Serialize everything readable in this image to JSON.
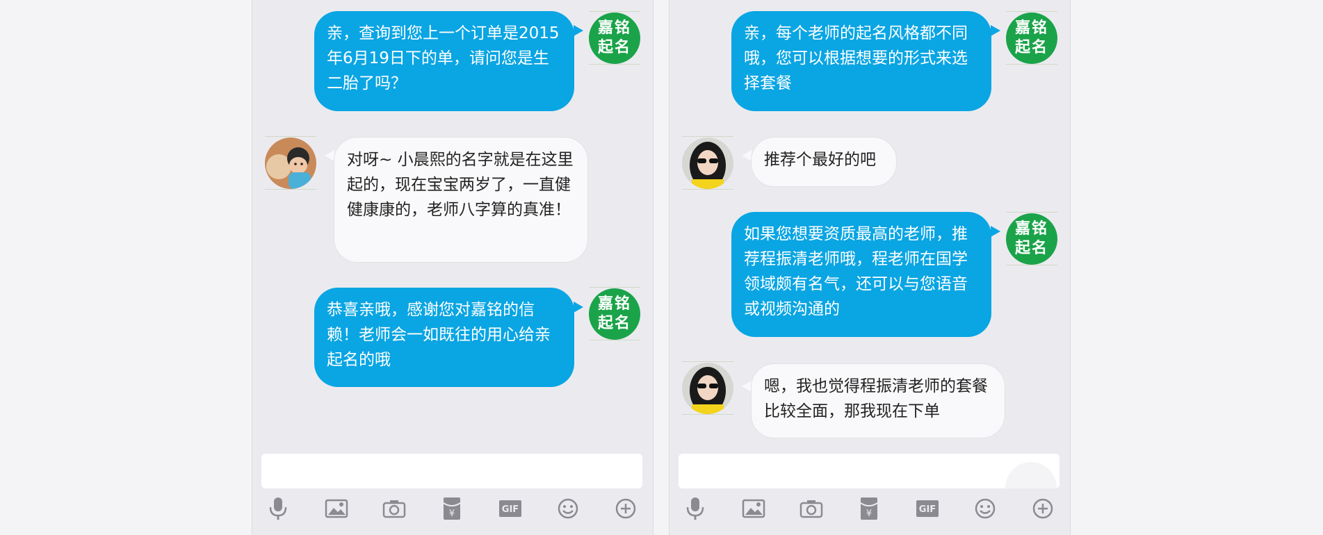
{
  "left_chat": {
    "messages": [
      {
        "from": "shop",
        "text": "亲，查询到您上一个订单是2015年6月19日下的单，请问您是生二胎了吗？"
      },
      {
        "from": "customer",
        "text": "对呀~ 小晨熙的名字就是在这里起的，现在宝宝两岁了，一直健健康康的，老师八字算的真准！"
      },
      {
        "from": "shop",
        "text": "恭喜亲哦，感谢您对嘉铭的信赖！老师会一如既往的用心给亲起名的哦"
      }
    ]
  },
  "right_chat": {
    "messages": [
      {
        "from": "shop",
        "text": "亲，每个老师的起名风格都不同哦，您可以根据想要的形式来选择套餐"
      },
      {
        "from": "customer",
        "text": "推荐个最好的吧"
      },
      {
        "from": "shop",
        "text": "如果您想要资质最高的老师，推荐程振清老师哦，程老师在国学领域颇有名气，还可以与您语音或视频沟通的"
      },
      {
        "from": "customer",
        "text": "嗯，我也觉得程振清老师的套餐比较全面，那我现在下单"
      }
    ]
  },
  "shop_avatar": {
    "line1": "嘉铭",
    "line2": "起名"
  },
  "toolbar": {
    "icons": [
      "microphone-icon",
      "image-icon",
      "camera-icon",
      "red-packet-icon",
      "gif-icon",
      "emoji-icon",
      "plus-icon"
    ],
    "gif_label": "GIF",
    "yen_label": "¥"
  },
  "colors": {
    "shop_bubble": "#0aa5e3",
    "customer_bubble": "#f9f9fb",
    "shop_avatar_bg": "#1ba34a",
    "chat_bg": "#ebebef"
  }
}
